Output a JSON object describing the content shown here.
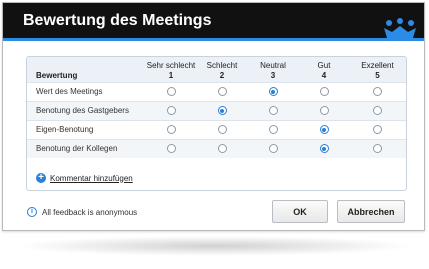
{
  "dialog": {
    "title": "Bewertung des Meetings",
    "accent_color": "#2c8be6",
    "logo_icon": "crown-people-logo"
  },
  "table": {
    "row_header": "Bewertung",
    "columns": [
      {
        "label": "Sehr schlecht",
        "number": "1"
      },
      {
        "label": "Schlecht",
        "number": "2"
      },
      {
        "label": "Neutral",
        "number": "3"
      },
      {
        "label": "Gut",
        "number": "4"
      },
      {
        "label": "Exzellent",
        "number": "5"
      }
    ],
    "rows": [
      {
        "label": "Wert des Meetings",
        "selected": 3
      },
      {
        "label": "Benotung des Gastgebers",
        "selected": 2
      },
      {
        "label": "Eigen-Benotung",
        "selected": 4
      },
      {
        "label": "Benotung der Kollegen",
        "selected": 4
      }
    ]
  },
  "add_comment": "Kommentar hinzufügen",
  "info": "All feedback is anonymous",
  "buttons": {
    "ok": "OK",
    "cancel": "Abbrechen"
  }
}
